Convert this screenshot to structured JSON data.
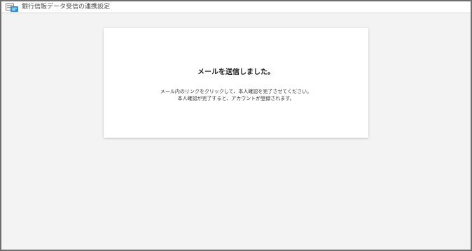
{
  "window": {
    "title": "銀行信販データ受信の連携設定",
    "app_icon": "bank-data-app-icon"
  },
  "card": {
    "heading": "メールを送信しました。",
    "line1": "メール内のリンクをクリックして、本人確認を完了させてください。",
    "line2": "本人確認が完了すると、アカウントが登録されます。"
  },
  "colors": {
    "background": "#f3f3f3",
    "card": "#ffffff",
    "border": "#6e6e6e",
    "icon_accent": "#2f8fd0"
  }
}
